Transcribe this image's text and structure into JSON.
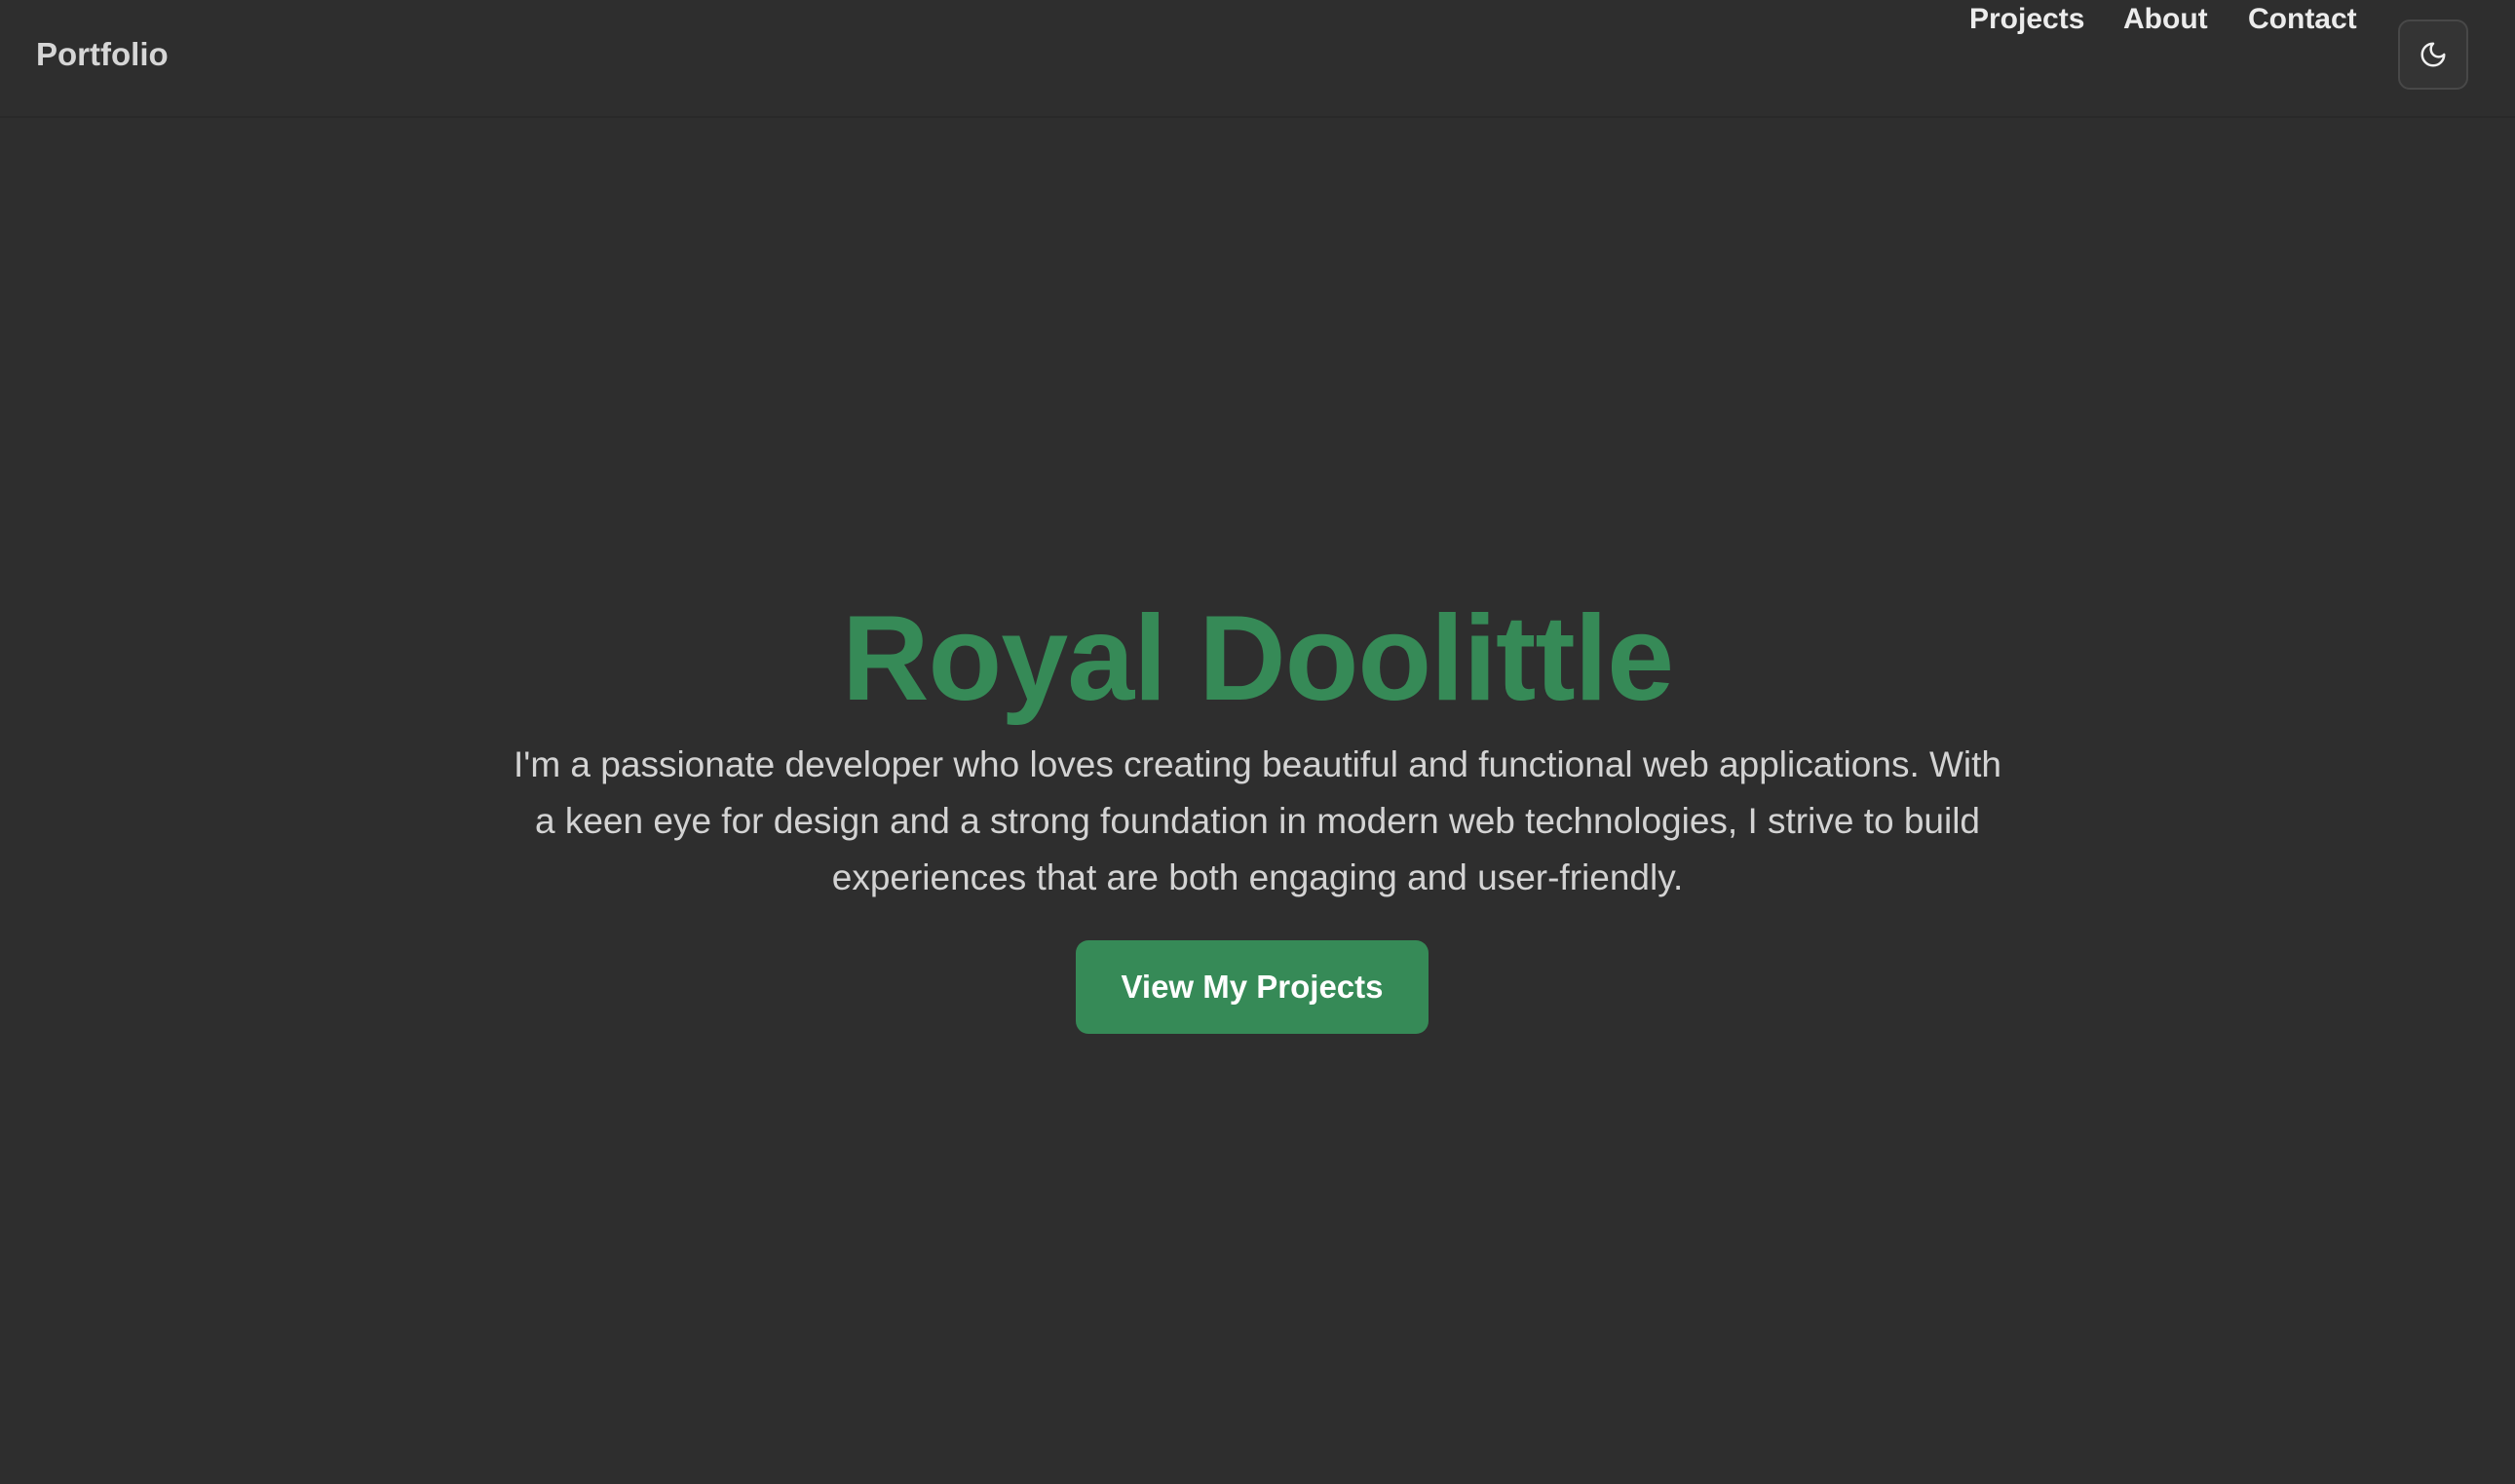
{
  "navbar": {
    "brand": "Portfolio",
    "links": [
      {
        "label": "Projects"
      },
      {
        "label": "About"
      },
      {
        "label": "Contact"
      }
    ],
    "theme_toggle_icon": "moon-icon"
  },
  "hero": {
    "title": "Royal Doolittle",
    "description": "I'm a passionate developer who loves creating beautiful and functional web applications. With a keen eye for design and a strong foundation in modern web technologies, I strive to build experiences that are both engaging and user-friendly.",
    "cta_label": "View My Projects"
  },
  "colors": {
    "background": "#2e2e2e",
    "accent": "#368a57",
    "nav_text": "#ececec",
    "body_text": "#d3d3d3"
  }
}
